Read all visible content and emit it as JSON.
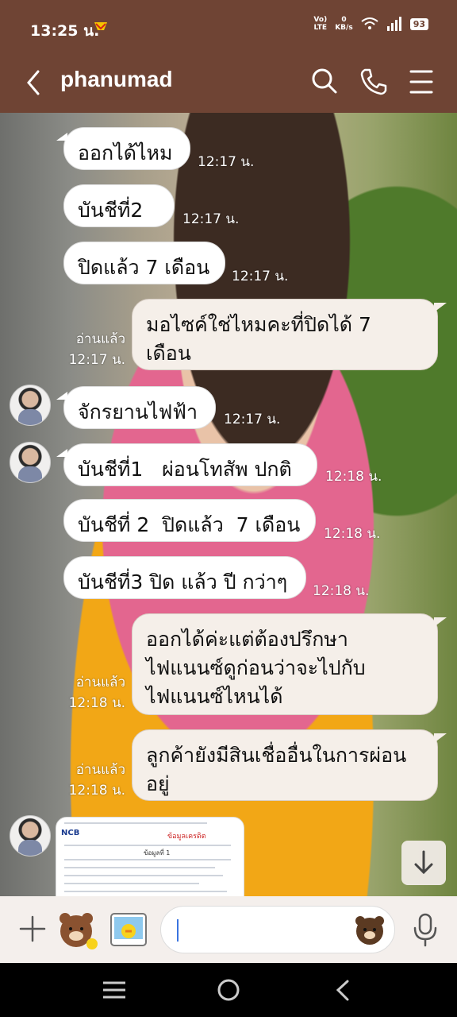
{
  "status": {
    "time": "13:25 น.",
    "volte_top": "Vo)",
    "volte_bottom": "LTE",
    "net_top": "0",
    "net_bottom": "KB/s",
    "battery": "93"
  },
  "header": {
    "title": "phanumad"
  },
  "messages": [
    {
      "text": "ออกได้ไหม",
      "time": "12:17 น."
    },
    {
      "text": "บันชีที่2",
      "time": "12:17 น."
    },
    {
      "text": "ปิดแล้ว 7 เดือน",
      "time": "12:17 น."
    },
    {
      "text": "มอไซค์ใช่ไหมคะที่ปิดได้ 7\nเดือน",
      "read": "อ่านแล้ว",
      "time": "12:17 น."
    },
    {
      "text": "จักรยานไฟฟ้า",
      "time": "12:17 น."
    },
    {
      "text": "บันชีที่1   ผ่อนโทสัพ ปกติ",
      "time": "12:18 น."
    },
    {
      "text": "บันชีที่ 2  ปิดแล้ว  7 เดือน",
      "time": "12:18 น."
    },
    {
      "text": "บันชีที่3 ปิด แล้ว ปี กว่าๆ",
      "time": "12:18 น."
    },
    {
      "text": "ออกได้ค่ะแต่ต้องปรึกษา\nไฟแนนซ์ดูก่อนว่าจะไปกับ\nไฟแนนซ์ไหนได้",
      "read": "อ่านแล้ว",
      "time": "12:18 น."
    },
    {
      "text": "ลูกค้ายังมีสินเชื่ออื่นในการผ่อน\nอยู่",
      "read": "อ่านแล้ว",
      "time": "12:18 น."
    }
  ],
  "attachment": {
    "logo": "NCB",
    "doc_title": "ข้อมูลเครดิต",
    "section": "ข้อมูลที่ 1"
  },
  "colors": {
    "header_bg": "#6f4434",
    "bubble_in": "#ffffff",
    "bubble_out": "#f5efe9",
    "input_bg": "#f4efec"
  },
  "icons": [
    "back-arrow-icon",
    "search-icon",
    "phone-icon",
    "menu-icon",
    "plus-icon",
    "sticker-icon",
    "emoji-icon",
    "mic-icon",
    "scroll-down-icon"
  ]
}
